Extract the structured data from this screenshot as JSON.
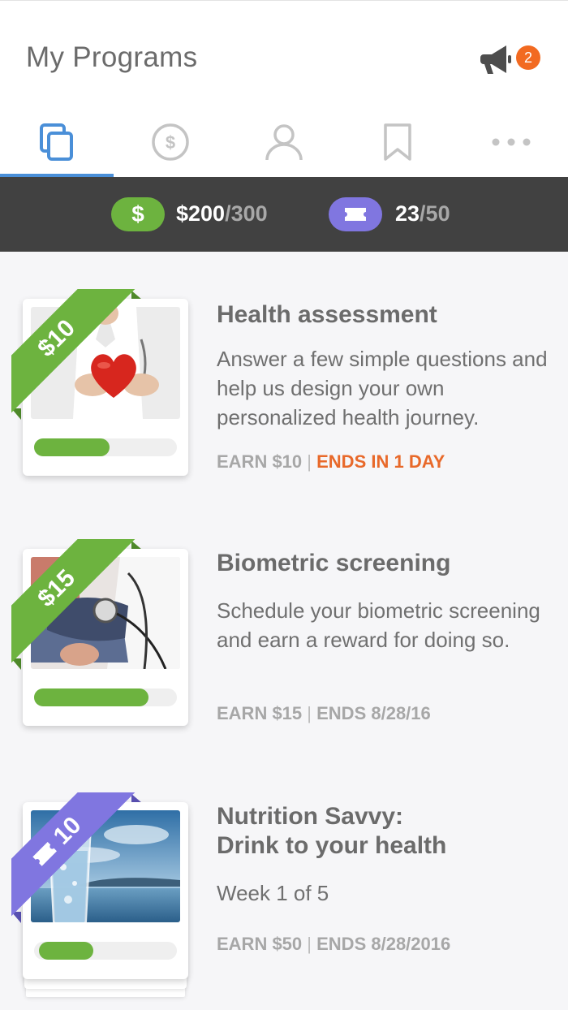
{
  "header": {
    "title": "My Programs",
    "notification_count": "2"
  },
  "tabs": [
    {
      "name": "programs",
      "icon": "copy-icon",
      "active": true
    },
    {
      "name": "rewards",
      "icon": "dollar-circle-icon",
      "active": false
    },
    {
      "name": "profile",
      "icon": "user-icon",
      "active": false
    },
    {
      "name": "saved",
      "icon": "bookmark-icon",
      "active": false
    },
    {
      "name": "more",
      "icon": "more-icon",
      "active": false
    }
  ],
  "stats": {
    "dollar_symbol": "$",
    "dollars_earned": "$200",
    "dollars_total": "/300",
    "tickets_earned": "23",
    "tickets_total": "/50"
  },
  "programs": [
    {
      "badge": "$10",
      "title": "Health assessment",
      "description": "Answer a few simple questions and help us design your own personalized health journey.",
      "earn": "EARN $10",
      "separator": "|",
      "ends": "ENDS IN 1 DAY",
      "progress": 0.53
    },
    {
      "badge": "$15",
      "title": "Biometric screening",
      "description": "Schedule your biometric screening and earn a reward for doing so.",
      "earn": "EARN $15",
      "separator": "|",
      "ends": "ENDS 8/28/16",
      "progress": 0.8
    },
    {
      "badge": "10",
      "title_line1": "Nutrition Savvy:",
      "title_line2": "Drink to your health",
      "description": "Week 1 of 5",
      "earn": "EARN $50",
      "separator": "|",
      "ends": "ENDS 8/28/2016",
      "progress": 0.38
    }
  ],
  "colors": {
    "accent_blue": "#4a8fd8",
    "green": "#6db33f",
    "purple": "#8076e0",
    "orange": "#f26a21",
    "dark_bar": "#414141"
  }
}
